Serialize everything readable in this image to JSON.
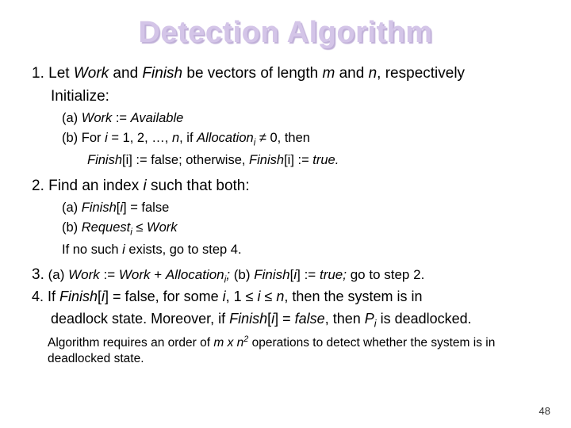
{
  "title": "Detection Algorithm",
  "step1": {
    "intro_a": "1. Let ",
    "work": "Work",
    "intro_b": " and ",
    "finish": "Finish",
    "intro_c": " be vectors of length ",
    "m": "m",
    "intro_d": " and ",
    "n": "n",
    "intro_e": ", respectively",
    "init": "Initialize:",
    "a_pre": "(a) ",
    "a_work": "Work",
    "a_mid": " := ",
    "a_avail": "Available",
    "b_pre": "(b)  For ",
    "b_i": "i",
    "b_eq": " = 1, 2, …, ",
    "b_n": "n",
    "b_if": ", if ",
    "b_alloc": "Allocation",
    "b_sub": "i",
    "b_ne": " ≠ 0, then",
    "b2_finish": "Finish",
    "b2_bracket": "[i] := false; otherwise, ",
    "b2_finish2": "Finish",
    "b2_rest": "[i] := ",
    "b2_true": "true."
  },
  "step2": {
    "intro_a": "2. Find an index ",
    "i": "i",
    "intro_b": " such that both:",
    "a_pre": "(a)  ",
    "a_finish": "Finish",
    "a_rest": "[",
    "a_i": "i",
    "a_close": "] = false",
    "b_pre": "(b)  ",
    "b_req": "Request",
    "b_sub": "i",
    "b_le": " ≤ ",
    "b_work": "Work",
    "c_pre": "If no such ",
    "c_i": "i",
    "c_rest": " exists, go to step 4."
  },
  "step3": {
    "num": "3.",
    "a_pre": "  (a) ",
    "a_work": "Work",
    "a_mid": " := ",
    "a_work2": "Work",
    "a_plus": " + ",
    "a_alloc": "Allocation",
    "a_sub": "i",
    "a_semi": ";",
    "b_pre": " (b) ",
    "b_finish": "Finish",
    "b_bracket": "[",
    "b_i": "i",
    "b_close": "] := ",
    "b_true": "true;",
    "b_go": " go to step 2."
  },
  "step4": {
    "pre": "4.  If ",
    "finish": "Finish",
    "b1": "[",
    "i1": "i",
    "b2": "] = false, for some ",
    "i2": "i",
    "range": ", 1 ≤ ",
    "i3": "i",
    "le2": " ≤  ",
    "n": "n",
    "then": ", then the system is in",
    "line2a": "deadlock state. Moreover, if ",
    "finish2": "Finish",
    "br1": "[",
    "i4": "i",
    "br2": "] = ",
    "false": "false",
    "then2": ", then ",
    "p": "P",
    "psub": "i",
    "dead": " is deadlocked."
  },
  "note": {
    "a": "Algorithm requires an order of ",
    "m": "m x n",
    "sup": "2",
    "b": " operations to detect whether the system is in deadlocked state."
  },
  "pagenum": "48"
}
